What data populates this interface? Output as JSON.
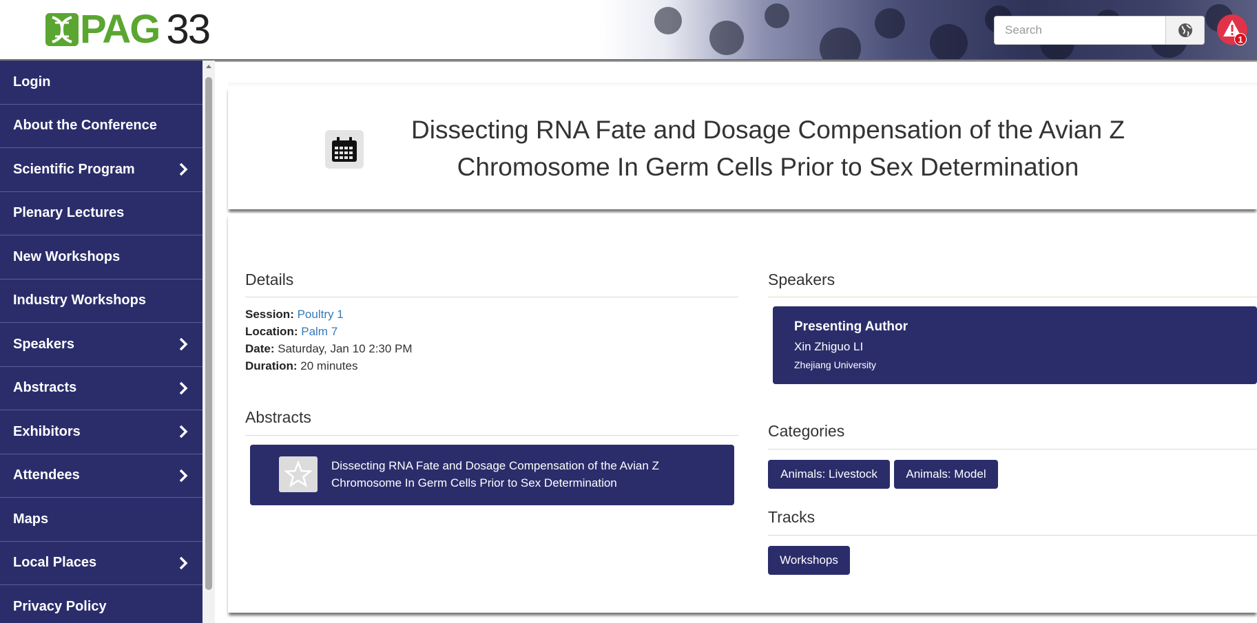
{
  "header": {
    "logo_text": "PAG",
    "logo_number": "33",
    "search_placeholder": "Search",
    "alert_count": "1"
  },
  "sidebar": {
    "items": [
      {
        "label": "Login",
        "has_submenu": false
      },
      {
        "label": "About the Conference",
        "has_submenu": false
      },
      {
        "label": "Scientific Program",
        "has_submenu": true
      },
      {
        "label": "Plenary Lectures",
        "has_submenu": false
      },
      {
        "label": "New Workshops",
        "has_submenu": false
      },
      {
        "label": "Industry Workshops",
        "has_submenu": false
      },
      {
        "label": "Speakers",
        "has_submenu": true
      },
      {
        "label": "Abstracts",
        "has_submenu": true
      },
      {
        "label": "Exhibitors",
        "has_submenu": true
      },
      {
        "label": "Attendees",
        "has_submenu": true
      },
      {
        "label": "Maps",
        "has_submenu": false
      },
      {
        "label": "Local Places",
        "has_submenu": true
      },
      {
        "label": "Privacy Policy",
        "has_submenu": false
      }
    ]
  },
  "event": {
    "title_line1": "Dissecting RNA Fate and Dosage Compensation of the Avian Z",
    "title_line2": "Chromosome In Germ Cells Prior to Sex Determination"
  },
  "details": {
    "heading": "Details",
    "session_label": "Session:",
    "session_value": "Poultry 1",
    "location_label": "Location:",
    "location_value": "Palm 7",
    "date_label": "Date:",
    "date_value": "Saturday, Jan 10 2:30 PM",
    "duration_label": "Duration:",
    "duration_value": "20 minutes"
  },
  "abstracts": {
    "heading": "Abstracts",
    "item_line1": "Dissecting RNA Fate and Dosage Compensation of the Avian Z",
    "item_line2": "Chromosome In Germ Cells Prior to Sex Determination"
  },
  "speakers": {
    "heading": "Speakers",
    "role": "Presenting Author",
    "name": "Xin Zhiguo LI",
    "affiliation": "Zhejiang University"
  },
  "categories": {
    "heading": "Categories",
    "items": [
      "Animals: Livestock",
      "Animals: Model"
    ]
  },
  "tracks": {
    "heading": "Tracks",
    "items": [
      "Workshops"
    ]
  },
  "colors": {
    "nav_bg": "#2b2d6b",
    "logo_green": "#5aa631",
    "link": "#337ab7",
    "badge": "#d8121f"
  }
}
